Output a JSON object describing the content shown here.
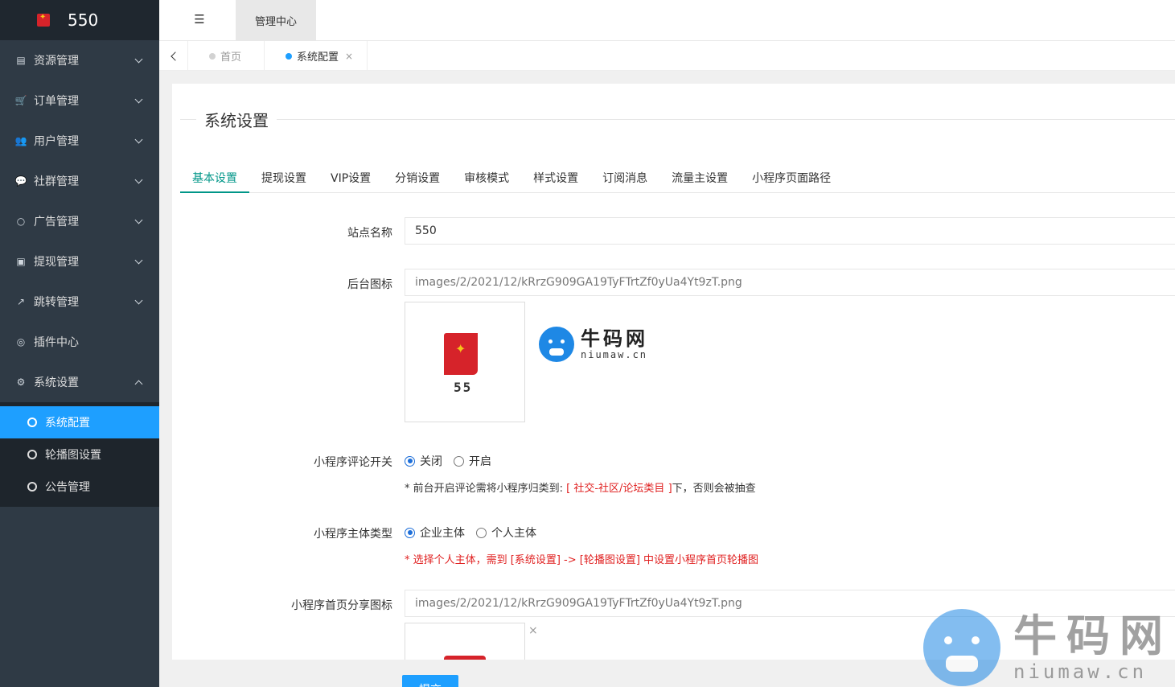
{
  "brand": {
    "title": "550"
  },
  "header": {
    "active_tab": "管理中心"
  },
  "sidebar": {
    "items": [
      {
        "icon": "book-icon",
        "glyph": "▤",
        "label": "资源管理",
        "expandable": true
      },
      {
        "icon": "cart-icon",
        "glyph": "🛒",
        "label": "订单管理",
        "expandable": true
      },
      {
        "icon": "users-icon",
        "glyph": "👥",
        "label": "用户管理",
        "expandable": true
      },
      {
        "icon": "chat-icon",
        "glyph": "💬",
        "label": "社群管理",
        "expandable": true
      },
      {
        "icon": "circle-icon",
        "glyph": "○",
        "label": "广告管理",
        "expandable": true
      },
      {
        "icon": "money-icon",
        "glyph": "▣",
        "label": "提现管理",
        "expandable": true
      },
      {
        "icon": "share-icon",
        "glyph": "↗",
        "label": "跳转管理",
        "expandable": true
      },
      {
        "icon": "plugin-icon",
        "glyph": "◎",
        "label": "插件中心",
        "expandable": false
      },
      {
        "icon": "gear-icon",
        "glyph": "⚙",
        "label": "系统设置",
        "expandable": true,
        "expanded": true
      }
    ],
    "sub_items": [
      {
        "label": "系统配置",
        "active": true
      },
      {
        "label": "轮播图设置",
        "active": false
      },
      {
        "label": "公告管理",
        "active": false
      }
    ]
  },
  "page_tabs": [
    {
      "label": "首页",
      "active": false
    },
    {
      "label": "系统配置",
      "active": true,
      "close": "×"
    }
  ],
  "content": {
    "section_title": "系统设置",
    "tabs": [
      "基本设置",
      "提现设置",
      "VIP设置",
      "分销设置",
      "审核模式",
      "样式设置",
      "订阅消息",
      "流量主设置",
      "小程序页面路径"
    ],
    "active_tab": "基本设置",
    "fields": {
      "site_name": {
        "label": "站点名称",
        "value": "550"
      },
      "admin_icon": {
        "label": "后台图标",
        "value": "images/2/2021/12/kRrzG909GA19TyFTrtZf0yUa4Yt9zT.png",
        "preview_caption": "55"
      },
      "comment_switch": {
        "label": "小程序评论开关",
        "options": [
          "关闭",
          "开启"
        ],
        "selected": "关闭",
        "hint_prefix": "* 前台开启评论需将小程序归类到: ",
        "hint_highlight": "[ 社交-社区/论坛类目 ]",
        "hint_suffix": "下，否则会被抽查"
      },
      "entity_type": {
        "label": "小程序主体类型",
        "options": [
          "企业主体",
          "个人主体"
        ],
        "selected": "企业主体",
        "hint": "* 选择个人主体，需到 [系统设置] -> [轮播图设置] 中设置小程序首页轮播图"
      },
      "share_icon": {
        "label": "小程序首页分享图标",
        "value": "images/2/2021/12/kRrzG909GA19TyFTrtZf0yUa4Yt9zT.png",
        "remove": "×"
      }
    },
    "submit_label": "提交"
  },
  "watermark": {
    "cn": "牛码网",
    "en": "niumaw.cn"
  },
  "colors": {
    "sidebar_bg": "#2f3a45",
    "accent_blue": "#1e9fff",
    "tab_active": "#009688",
    "hint_red": "#e02020"
  }
}
